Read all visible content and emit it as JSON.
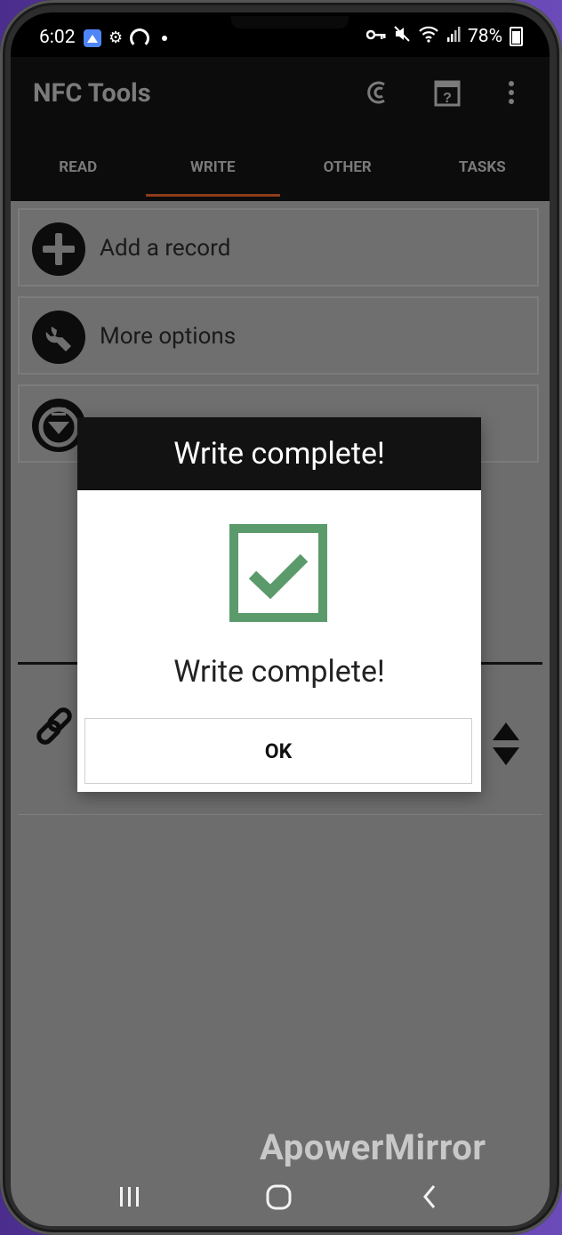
{
  "status_bar": {
    "time": "6:02",
    "battery": "78%"
  },
  "app": {
    "title": "NFC Tools",
    "tabs": [
      {
        "label": "READ",
        "active": false
      },
      {
        "label": "WRITE",
        "active": true
      },
      {
        "label": "OTHER",
        "active": false
      },
      {
        "label": "TASKS",
        "active": false
      }
    ]
  },
  "content": {
    "add_record_label": "Add a record",
    "more_options_label": "More options"
  },
  "dialog": {
    "title": "Write complete!",
    "message": "Write complete!",
    "ok_label": "OK",
    "check_color": "#5b9a6a"
  },
  "watermark": "ApowerMirror"
}
